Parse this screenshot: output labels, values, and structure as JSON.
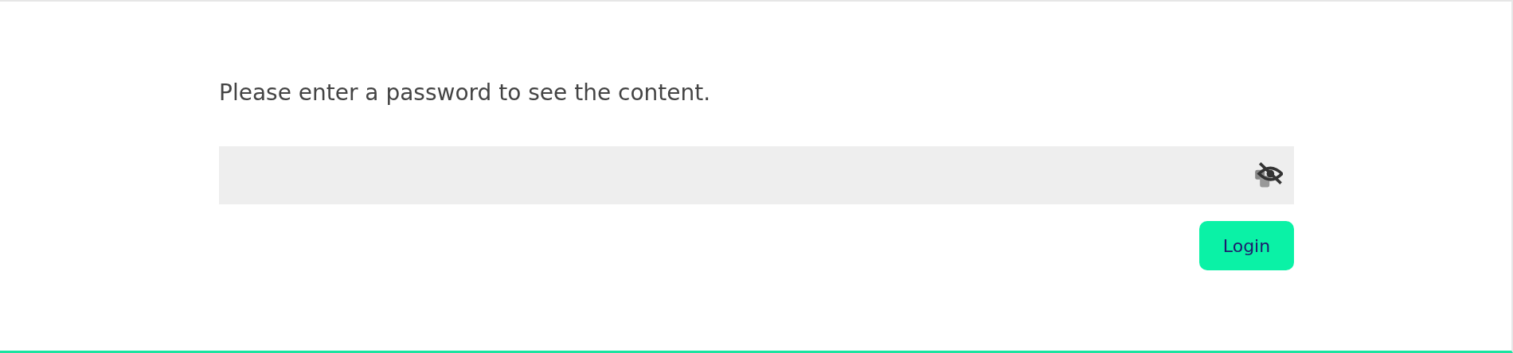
{
  "prompt": "Please enter a password to see the content.",
  "login_button": {
    "label": "Login"
  }
}
